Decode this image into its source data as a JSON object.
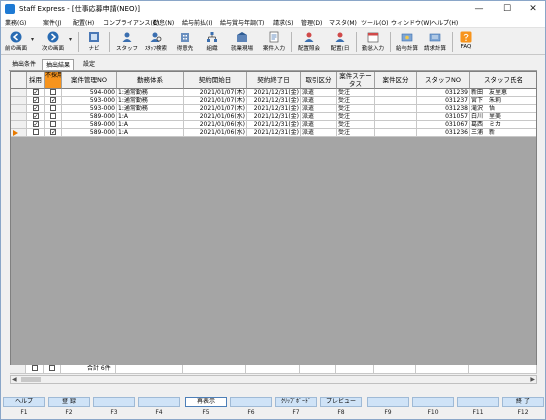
{
  "window": {
    "title": "Staff Express - [仕事応募申請(NEO)]",
    "min": "—",
    "max": "☐",
    "close": "✕"
  },
  "menu": [
    "業務(G)",
    "案件(J)",
    "配置(H)",
    "コンプライアンス(C)",
    "勤怠(N)",
    "給与前払(I)",
    "給与賞与年調(T)",
    "請求(S)",
    "管理(D)",
    "マスタ(M)",
    "ツール(O)",
    "ウィンドウ(W)",
    "ヘルプ(H)"
  ],
  "toolbar": {
    "back": "前の画面",
    "next": "次の画面",
    "items": [
      "ナビ",
      "スタッフ",
      "ｽﾀｯﾌ検索",
      "得意先",
      "組織",
      "就業現場",
      "案件入力",
      "配置照会",
      "配置(日",
      "勤怠入力",
      "給与計算",
      "請求計算",
      "FAQ"
    ],
    "icons": [
      "navi-icon",
      "staff-icon",
      "staff-search-icon",
      "customer-icon",
      "organization-icon",
      "workplace-icon",
      "job-entry-icon",
      "placement-query-icon",
      "placement-daily-icon",
      "attendance-icon",
      "payroll-icon",
      "billing-icon",
      "faq-icon"
    ]
  },
  "tabs": [
    "抽出条件",
    "抽出結果",
    "設定"
  ],
  "grid": {
    "columns": [
      "",
      "採用",
      "不採用",
      "案件管理NO",
      "勤務体系",
      "契約開始日",
      "契約終了日",
      "取引区分",
      "案件ステータス",
      "案件区分",
      "スタッフNO",
      "スタッフ氏名"
    ],
    "rows": [
      {
        "adopt": true,
        "reject": false,
        "no": "594-000",
        "type": "1:通常勤務",
        "start": "2021/01/07(木)",
        "end": "2021/12/31(金)",
        "deal": "派遣",
        "status": "受注",
        "kind": "",
        "staff_no": "031239",
        "name": "新田　友里恵",
        "current": false
      },
      {
        "adopt": true,
        "reject": true,
        "no": "593-000",
        "type": "1:通常勤務",
        "start": "2021/01/07(木)",
        "end": "2021/12/31(金)",
        "deal": "派遣",
        "status": "受注",
        "kind": "",
        "staff_no": "031237",
        "name": "宮下　朱莉",
        "current": false
      },
      {
        "adopt": true,
        "reject": false,
        "no": "593-000",
        "type": "1:通常勤務",
        "start": "2021/01/07(木)",
        "end": "2021/12/31(金)",
        "deal": "派遣",
        "status": "受注",
        "kind": "",
        "staff_no": "031238",
        "name": "滝沢　悟",
        "current": false
      },
      {
        "adopt": true,
        "reject": false,
        "no": "589-000",
        "type": "1:A",
        "start": "2021/01/06(水)",
        "end": "2021/12/31(金)",
        "deal": "派遣",
        "status": "受注",
        "kind": "",
        "staff_no": "031057",
        "name": "白川　里美",
        "current": false
      },
      {
        "adopt": true,
        "reject": false,
        "no": "589-000",
        "type": "1:A",
        "start": "2021/01/06(水)",
        "end": "2021/12/31(金)",
        "deal": "派遣",
        "status": "受注",
        "kind": "",
        "staff_no": "031067",
        "name": "葛西　ミカ",
        "current": false
      },
      {
        "adopt": false,
        "reject": true,
        "no": "589-000",
        "type": "1:A",
        "start": "2021/01/06(水)",
        "end": "2021/12/31(金)",
        "deal": "派遣",
        "status": "受注",
        "kind": "",
        "staff_no": "031236",
        "name": "三浦　新",
        "current": true
      }
    ],
    "total": "合計 6件"
  },
  "fkeys": [
    {
      "label": "ヘルプ",
      "key": "F1"
    },
    {
      "label": "登 録",
      "key": "F2"
    },
    {
      "label": "",
      "key": "F3"
    },
    {
      "label": "",
      "key": "F4"
    },
    {
      "label": "再表示",
      "key": "F5"
    },
    {
      "label": "",
      "key": "F6"
    },
    {
      "label": "ｸﾘｯﾌﾟﾎﾞｰﾄﾞ",
      "key": "F7"
    },
    {
      "label": "プレビュー",
      "key": "F8"
    },
    {
      "label": "",
      "key": "F9"
    },
    {
      "label": "",
      "key": "F10"
    },
    {
      "label": "",
      "key": "F11"
    },
    {
      "label": "終 了",
      "key": "F12"
    }
  ],
  "colors": {
    "accent_orange": "#f7941d",
    "fkey_blue": "#cfe3f7",
    "grid_bg": "#a5a5a5"
  }
}
